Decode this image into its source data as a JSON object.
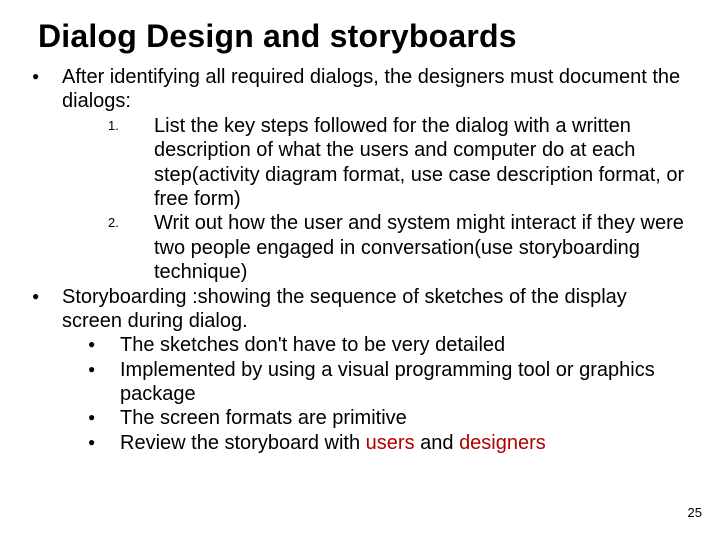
{
  "title": "Dialog Design and storyboards",
  "b1_intro": "After identifying all required dialogs, the designers must document the dialogs:",
  "b1_n1": "List the key steps followed for the dialog with a written description of what the users and computer do at each step(activity diagram format, use case description format, or free form)",
  "b1_n2": "Writ out how the user and system might interact if they were two people engaged in conversation(use storyboarding technique)",
  "b2_intro": "Storyboarding :showing the sequence of sketches of the display screen during dialog.",
  "b2_s1": "The sketches don't have to be very detailed",
  "b2_s2": "Implemented by using a visual programming tool or graphics package",
  "b2_s3": "The screen formats are primitive",
  "b2_s4a": "Review the storyboard with ",
  "b2_s4b": "users",
  "b2_s4c": " and ",
  "b2_s4d": "designers",
  "page_number": "25"
}
